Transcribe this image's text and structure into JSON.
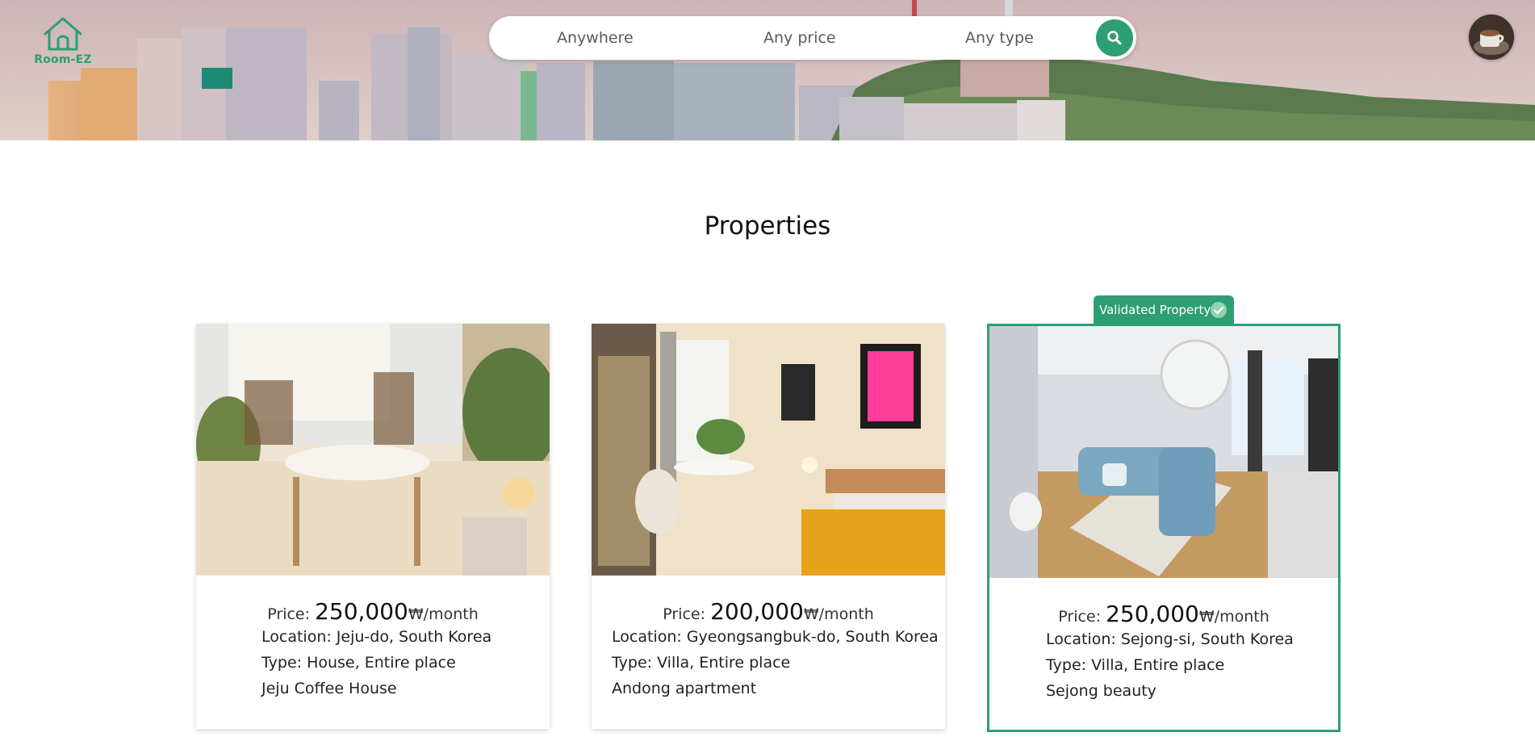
{
  "app": {
    "name": "Room-EZ"
  },
  "search": {
    "location": "Anywhere",
    "price": "Any price",
    "type": "Any type"
  },
  "page": {
    "title": "Properties"
  },
  "badge": {
    "label": "Validated Property"
  },
  "accent_color": "#2e9e74",
  "properties": [
    {
      "price_label": "Price:",
      "price": "250,000",
      "price_unit": "₩/month",
      "location": "Location: Jeju-do, South Korea",
      "type": "Type: House, Entire place",
      "name": "Jeju Coffee House",
      "validated": false
    },
    {
      "price_label": "Price:",
      "price": "200,000",
      "price_unit": "₩/month",
      "location": "Location: Gyeongsangbuk-do, South Korea",
      "type": "Type: Villa, Entire place",
      "name": "Andong apartment",
      "validated": false
    },
    {
      "price_label": "Price:",
      "price": "250,000",
      "price_unit": "₩/month",
      "location": "Location: Sejong-si, South Korea",
      "type": "Type: Villa, Entire place",
      "name": "Sejong beauty",
      "validated": true
    }
  ]
}
